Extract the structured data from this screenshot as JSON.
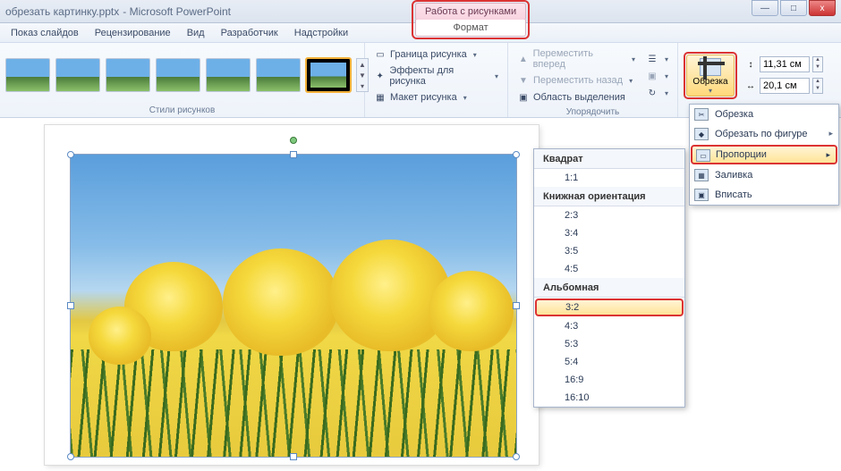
{
  "titlebar": {
    "filename": "обрезать картинку.pptx",
    "app": "Microsoft PowerPoint",
    "tool_context": "Работа с рисунками",
    "tool_tab": "Формат"
  },
  "menubar": {
    "items": [
      "Показ слайдов",
      "Рецензирование",
      "Вид",
      "Разработчик",
      "Надстройки"
    ]
  },
  "ribbon": {
    "styles_label": "Стили рисунков",
    "arrange_label": "Упорядочить",
    "border": "Граница рисунка",
    "effects": "Эффекты для рисунка",
    "layout": "Макет рисунка",
    "bring_forward": "Переместить вперед",
    "send_backward": "Переместить назад",
    "selection_pane": "Область выделения",
    "crop_label": "Обрезка",
    "height": "11,31 см",
    "width": "20,1 см"
  },
  "crop_menu": {
    "crop": "Обрезка",
    "crop_to_shape": "Обрезать по фигуре",
    "aspect": "Пропорции",
    "fill": "Заливка",
    "fit": "Вписать"
  },
  "aspect_menu": {
    "square_hdr": "Квадрат",
    "square": [
      "1:1"
    ],
    "portrait_hdr": "Книжная ориентация",
    "portrait": [
      "2:3",
      "3:4",
      "3:5",
      "4:5"
    ],
    "landscape_hdr": "Альбомная",
    "landscape": [
      "3:2",
      "4:3",
      "5:3",
      "5:4",
      "16:9",
      "16:10"
    ],
    "highlighted": "3:2"
  },
  "win": {
    "min": "—",
    "max": "□",
    "close": "x"
  }
}
